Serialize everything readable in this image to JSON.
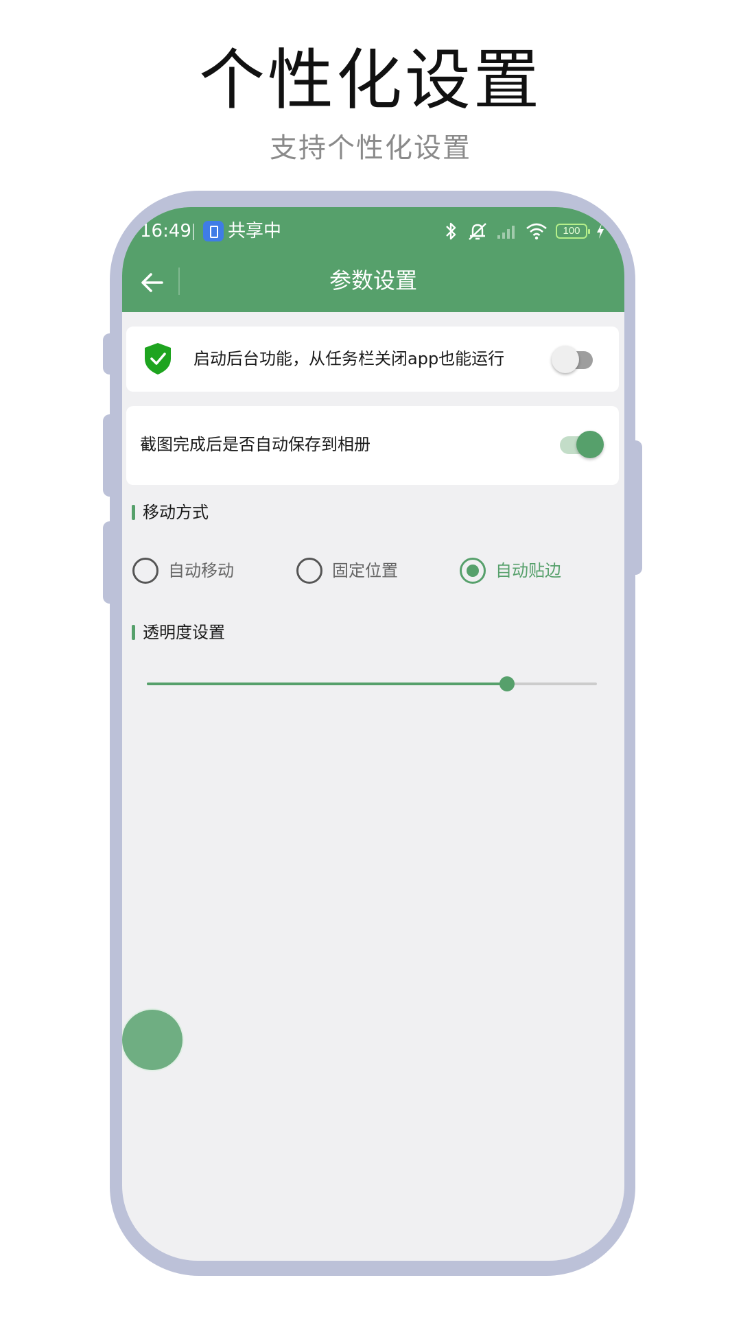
{
  "promo": {
    "title": "个性化设置",
    "subtitle": "支持个性化设置"
  },
  "status_bar": {
    "time": "16:49",
    "share_text": "共享中",
    "battery": "100",
    "icons": [
      "bluetooth-icon",
      "mute-icon",
      "signal-icon",
      "wifi-icon",
      "battery-icon",
      "charging-icon"
    ]
  },
  "toolbar": {
    "title": "参数设置",
    "back_icon": "arrow-left-icon"
  },
  "settings": {
    "background_run": {
      "label": "启动后台功能，从任务栏关闭app也能运行",
      "enabled": false,
      "icon": "shield-check-icon"
    },
    "auto_save": {
      "label": "截图完成后是否自动保存到相册",
      "enabled": true
    }
  },
  "move_mode": {
    "title": "移动方式",
    "options": [
      "自动移动",
      "固定位置",
      "自动贴边"
    ],
    "selected_index": 2
  },
  "opacity": {
    "title": "透明度设置",
    "value_fraction": 0.8
  },
  "colors": {
    "accent": "#56a06b",
    "frame": "#bcc1d8",
    "background": "#f0f0f2"
  }
}
